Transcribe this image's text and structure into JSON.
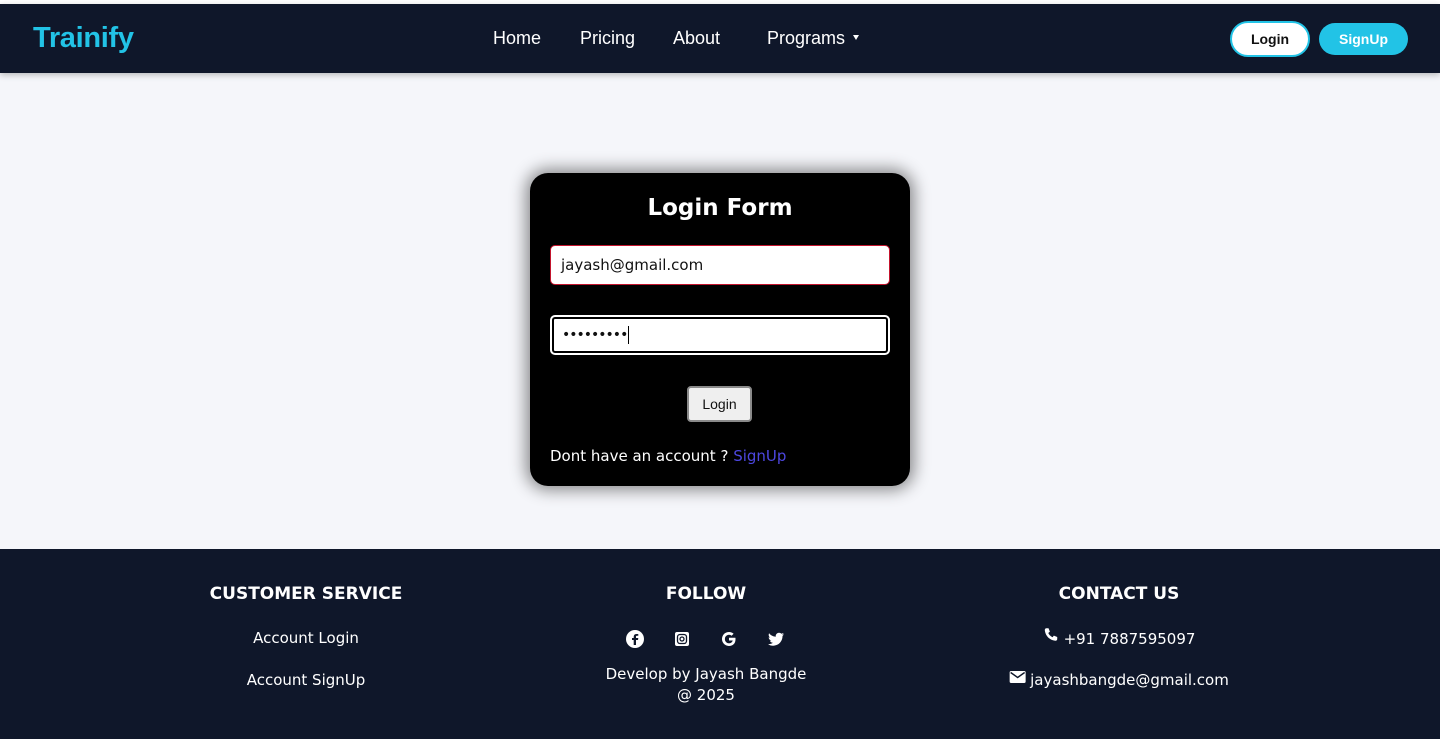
{
  "navbar": {
    "brand": "Trainify",
    "links": [
      "Home",
      "Pricing",
      "About",
      "Programs"
    ],
    "login_label": "Login",
    "signup_label": "SignUp"
  },
  "login_form": {
    "title": "Login Form",
    "email_value": "jayash@gmail.com",
    "password_value": "•••••••••",
    "submit_label": "Login",
    "no_account_text": "Dont have an account ?",
    "signup_link": "SignUp"
  },
  "footer": {
    "customer_service": {
      "heading": "CUSTOMER SERVICE",
      "items": [
        "Account Login",
        "Account SignUp"
      ]
    },
    "follow": {
      "heading": "FOLLOW",
      "icons": [
        "facebook-icon",
        "instagram-icon",
        "google-icon",
        "twitter-icon"
      ],
      "credit_line1": "Develop by Jayash Bangde",
      "credit_line2": "@ 2025"
    },
    "contact": {
      "heading": "CONTACT US",
      "phone": "+91 7887595097",
      "email": "jayashbangde@gmail.com"
    }
  },
  "colors": {
    "navbar_bg": "#0f172a",
    "accent": "#22c3e6",
    "card_bg": "#000000",
    "link": "#4d47e0"
  }
}
